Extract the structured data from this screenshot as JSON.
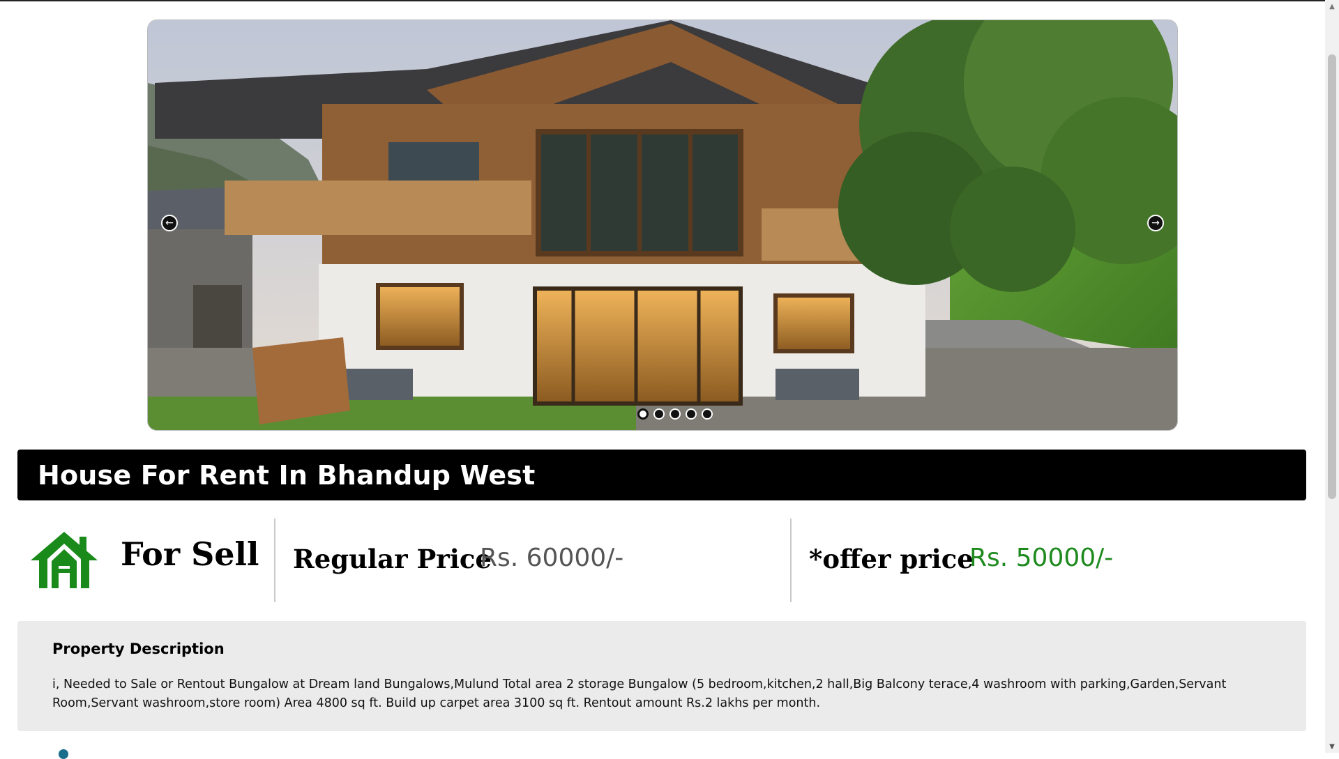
{
  "carousel": {
    "prev_icon": "arrow-left-icon",
    "next_icon": "arrow-right-icon",
    "slide_count": 5,
    "active_slide": 1
  },
  "listing": {
    "title": "House For Rent In Bhandup West",
    "status_icon": "house-icon",
    "status": "For Sell",
    "regular_price_label": "Regular Price",
    "regular_price": "Rs. 60000/-",
    "offer_price_label": "*offer price",
    "offer_price": "Rs. 50000/-"
  },
  "description": {
    "heading": "Property Description",
    "text": "i, Needed to Sale or Rentout Bungalow at Dream land Bungalows,Mulund Total area 2 storage Bungalow (5 bedroom,kitchen,2 hall,Big Balcony terace,4 washroom with parking,Garden,Servant Room,Servant washroom,store room) Area 4800 sq ft. Build up carpet area 3100 sq ft. Rentout amount Rs.2 lakhs per month."
  },
  "colors": {
    "title_bar_bg": "#000000",
    "offer_price": "#1e8a1e",
    "house_icon": "#1a8a1a",
    "description_bg": "#ebebeb"
  }
}
